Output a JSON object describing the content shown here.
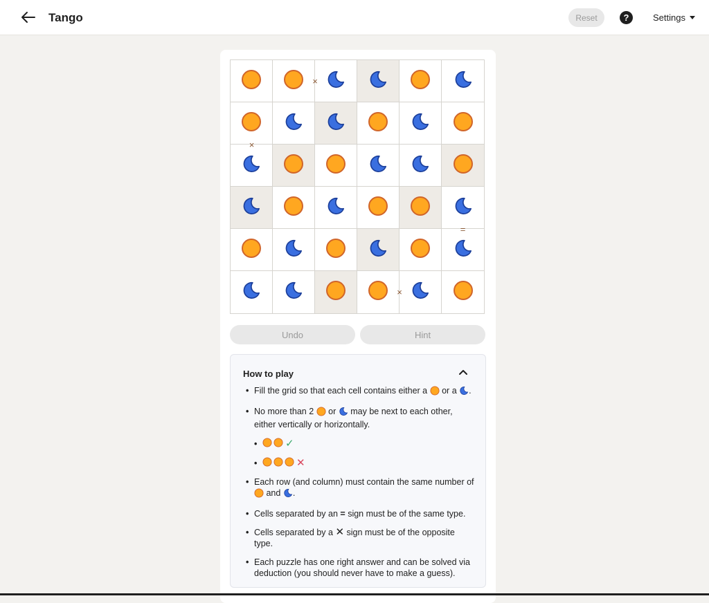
{
  "header": {
    "title": "Tango",
    "reset_label": "Reset",
    "help_label": "?",
    "settings_label": "Settings"
  },
  "board": {
    "rows": [
      [
        "sun",
        "sun",
        "moon",
        "moon",
        "sun",
        "moon"
      ],
      [
        "sun",
        "moon",
        "moon",
        "sun",
        "moon",
        "sun"
      ],
      [
        "moon",
        "sun",
        "sun",
        "moon",
        "moon",
        "sun"
      ],
      [
        "moon",
        "sun",
        "moon",
        "sun",
        "sun",
        "moon"
      ],
      [
        "sun",
        "moon",
        "sun",
        "moon",
        "sun",
        "moon"
      ],
      [
        "moon",
        "moon",
        "sun",
        "sun",
        "moon",
        "sun"
      ]
    ],
    "locked": [
      [
        false,
        false,
        false,
        true,
        false,
        false
      ],
      [
        false,
        false,
        true,
        false,
        false,
        false
      ],
      [
        false,
        true,
        false,
        false,
        false,
        true
      ],
      [
        true,
        false,
        false,
        false,
        true,
        false
      ],
      [
        false,
        false,
        false,
        true,
        false,
        false
      ],
      [
        false,
        false,
        true,
        false,
        false,
        false
      ]
    ],
    "constraints": [
      {
        "type": "×",
        "between": [
          [
            0,
            1
          ],
          [
            0,
            2
          ]
        ]
      },
      {
        "type": "×",
        "between": [
          [
            1,
            0
          ],
          [
            2,
            0
          ]
        ]
      },
      {
        "type": "=",
        "between": [
          [
            3,
            5
          ],
          [
            4,
            5
          ]
        ]
      },
      {
        "type": "×",
        "between": [
          [
            5,
            3
          ],
          [
            5,
            4
          ]
        ]
      }
    ],
    "colors": {
      "sun": "#ffa720",
      "sun_stroke": "#d0652a",
      "moon": "#3a6fe0",
      "moon_stroke": "#1c3f9a",
      "locked_bg": "#eeebe6"
    }
  },
  "controls": {
    "undo_label": "Undo",
    "hint_label": "Hint"
  },
  "how_to_play": {
    "title": "How to play",
    "rule1_a": "Fill the grid so that each cell contains either a",
    "rule1_b": "or a",
    "rule1_c": ".",
    "rule2_a": "No more than 2",
    "rule2_b": "or",
    "rule2_c": "may be next to each other, either vertically or horizontally.",
    "rule2_ok_mark": "✓",
    "rule2_bad_mark": "✕",
    "rule3_a": "Each row (and column) must contain the same number of",
    "rule3_b": "and",
    "rule3_c": ".",
    "rule4_a": "Cells separated by an",
    "rule4_sign": "=",
    "rule4_b": "sign must be of the same type.",
    "rule5_a": "Cells separated by a",
    "rule5_sign": "✕",
    "rule5_b": "sign must be of the opposite type.",
    "rule6": "Each puzzle has one right answer and can be solved via deduction (you should never have to make a guess)."
  }
}
